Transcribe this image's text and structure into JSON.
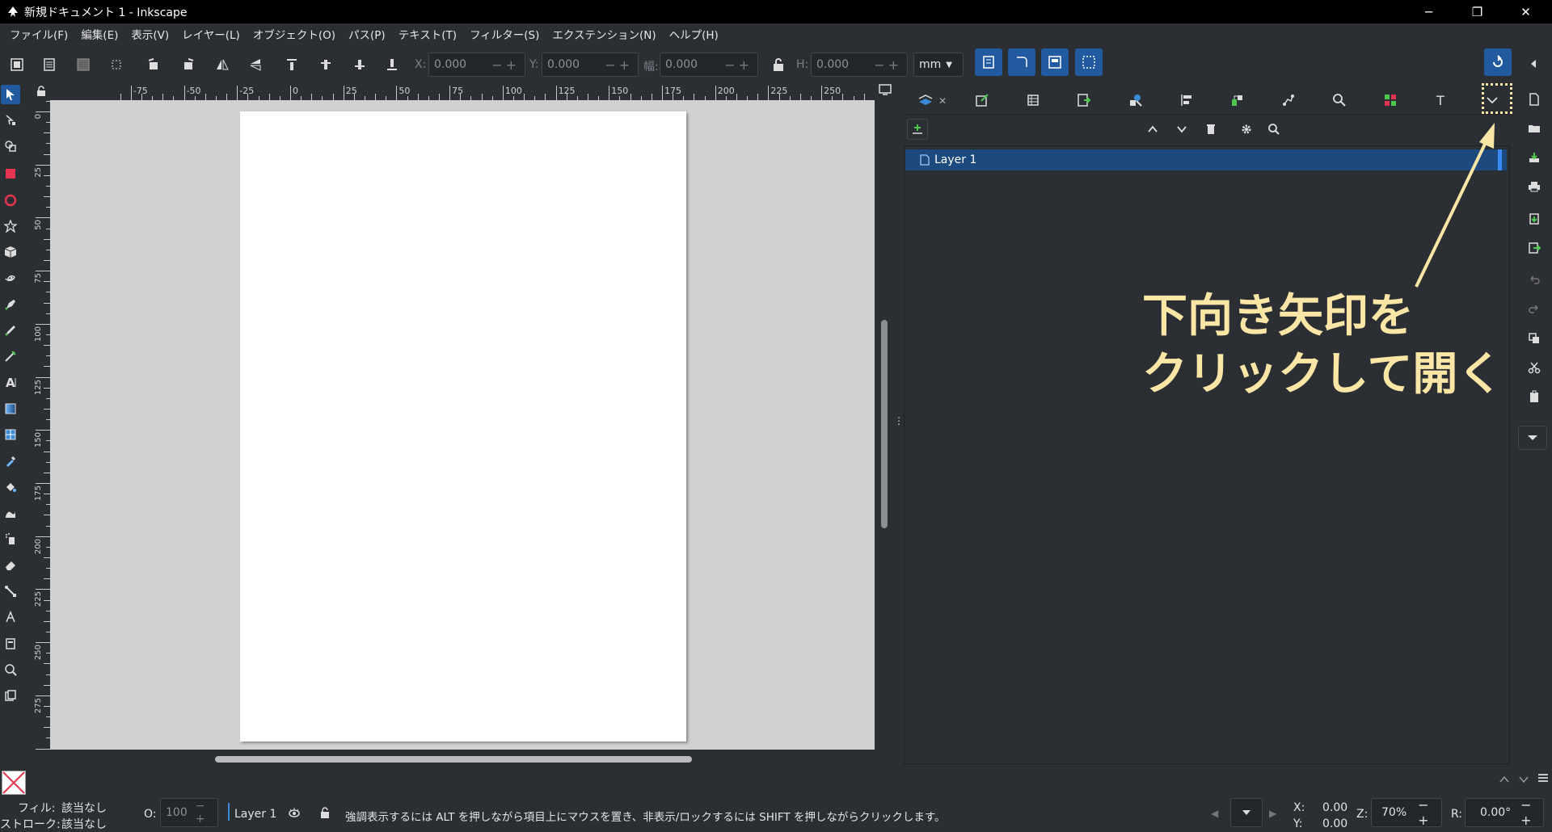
{
  "window": {
    "title": "新規ドキュメント 1 - Inkscape",
    "controls": [
      "─",
      "❐",
      "✕"
    ]
  },
  "menu": [
    "ファイル(F)",
    "編集(E)",
    "表示(V)",
    "レイヤー(L)",
    "オブジェクト(O)",
    "パス(P)",
    "テキスト(T)",
    "フィルター(S)",
    "エクステンション(N)",
    "ヘルプ(H)"
  ],
  "toolbar": {
    "x_label": "X:",
    "x_value": "0.000",
    "y_label": "Y:",
    "y_value": "0.000",
    "w_label": "幅:",
    "w_value": "0.000",
    "h_label": "H:",
    "h_value": "0.000",
    "unit": "mm"
  },
  "ruler": {
    "h_labels": [
      "-75",
      "-50",
      "-25",
      "0",
      "25",
      "50",
      "75",
      "100",
      "125",
      "150",
      "175",
      "200",
      "225",
      "250",
      "275"
    ],
    "v_labels": [
      "0",
      "25",
      "50",
      "75",
      "100",
      "125",
      "150",
      "175",
      "200",
      "225",
      "250",
      "275"
    ]
  },
  "layers": {
    "items": [
      {
        "name": "Layer 1"
      }
    ]
  },
  "annotation": {
    "line1": "下向き矢印を",
    "line2": "クリックして開く",
    "color": "#fbe6a6"
  },
  "status": {
    "fill_label": "フィル:",
    "fill_value": "該当なし",
    "stroke_label": "ストローク:",
    "stroke_value": "該当なし",
    "opacity_label": "O:",
    "opacity_value": "100",
    "current_layer": "Layer 1",
    "message": "強調表示するには ALT を押しながら項目上にマウスを置き、非表示/ロックするには SHIFT を押しながらクリックします。",
    "cursor_x_label": "X:",
    "cursor_x": "0.00",
    "cursor_y_label": "Y:",
    "cursor_y": "0.00",
    "zoom_label": "Z:",
    "zoom": "70%",
    "rotation_label": "R:",
    "rotation": "0.00°"
  },
  "colors": {
    "accent": "#215a9e",
    "selection": "#1c4a7f",
    "background": "#2b2e33",
    "canvas": "#d1d1d1"
  }
}
